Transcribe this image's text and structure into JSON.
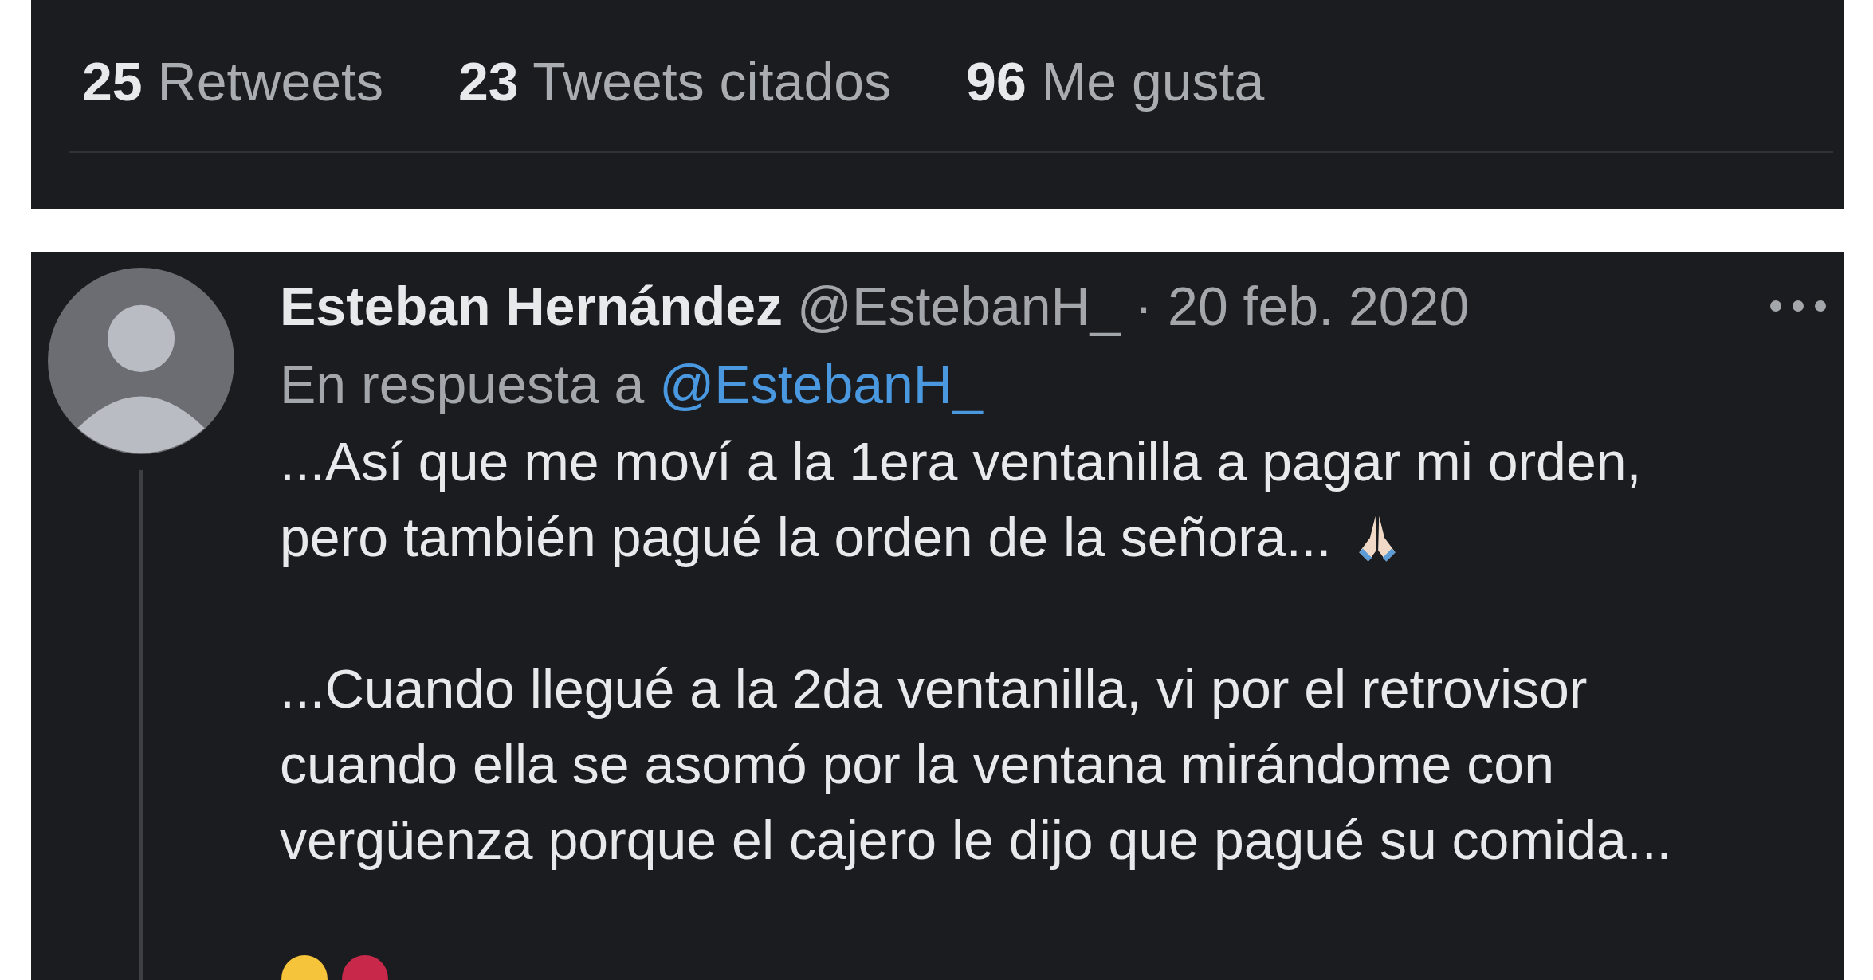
{
  "stats": [
    {
      "count": "25",
      "label": "Retweets"
    },
    {
      "count": "23",
      "label": "Tweets citados"
    },
    {
      "count": "96",
      "label": "Me gusta"
    }
  ],
  "tweet": {
    "author": {
      "name": "Esteban Hernández",
      "handle": "@EstebanH_",
      "date": "· 20 feb. 2020"
    },
    "reply_to": {
      "prefix": "En respuesta a",
      "handle": "@EstebanH_"
    },
    "paragraphs": [
      {
        "lines": [
          "...Así que me moví a la 1era ventanilla a pagar mi orden,",
          "pero también pagué la orden de la señora..."
        ],
        "praying_hands_after": true
      },
      {
        "lines": [
          "...Cuando llegué a la 2da ventanilla, vi por el retrovisor",
          "cuando ella se asomó por la ventana mirándome con",
          "vergüenza porque el cajero le dijo que pagué su comida..."
        ],
        "praying_hands_after": false
      }
    ]
  }
}
